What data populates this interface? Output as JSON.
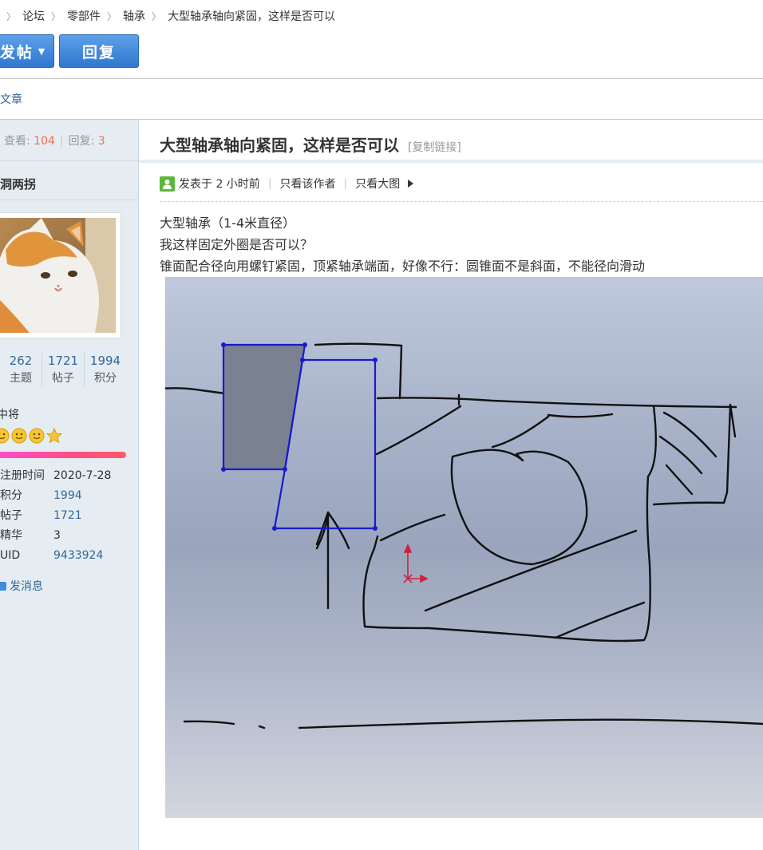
{
  "breadcrumb": [
    "论坛",
    "零部件",
    "轴承",
    "大型轴承轴向紧固，这样是否可以"
  ],
  "buttons": {
    "post": "发帖",
    "reply": "回复"
  },
  "article_link": "文章",
  "stats": {
    "views_label": "查看:",
    "views": "104",
    "replies_label": "回复:",
    "replies": "3"
  },
  "author": {
    "name": "洞两拐",
    "rank": "中将"
  },
  "author_stats": [
    {
      "value": "262",
      "label": "主题"
    },
    {
      "value": "1721",
      "label": "帖子"
    },
    {
      "value": "1994",
      "label": "积分"
    }
  ],
  "profile": [
    {
      "key": "注册时间",
      "value": "2020-7-28"
    },
    {
      "key": "积分",
      "value": "1994"
    },
    {
      "key": "帖子",
      "value": "1721"
    },
    {
      "key": "精华",
      "value": "3"
    },
    {
      "key": "UID",
      "value": "9433924"
    }
  ],
  "send_message": "发消息",
  "post": {
    "title": "大型轴承轴向紧固，这样是否可以",
    "copy_link": "[复制链接]",
    "posted": "发表于 2 小时前",
    "only_author": "只看该作者",
    "big_image": "只看大图",
    "lines": [
      "大型轴承（1-4米直径）",
      "我这样固定外圈是否可以？",
      "锥面配合径向用螺钉紧固，顶紧轴承端面，好像不行：圆锥面不是斜面，不能径向滑动"
    ]
  },
  "colors": {
    "link": "#336699",
    "count": "#f26c4f",
    "button": "#2f78cf",
    "sidebar": "#e5edf2"
  }
}
